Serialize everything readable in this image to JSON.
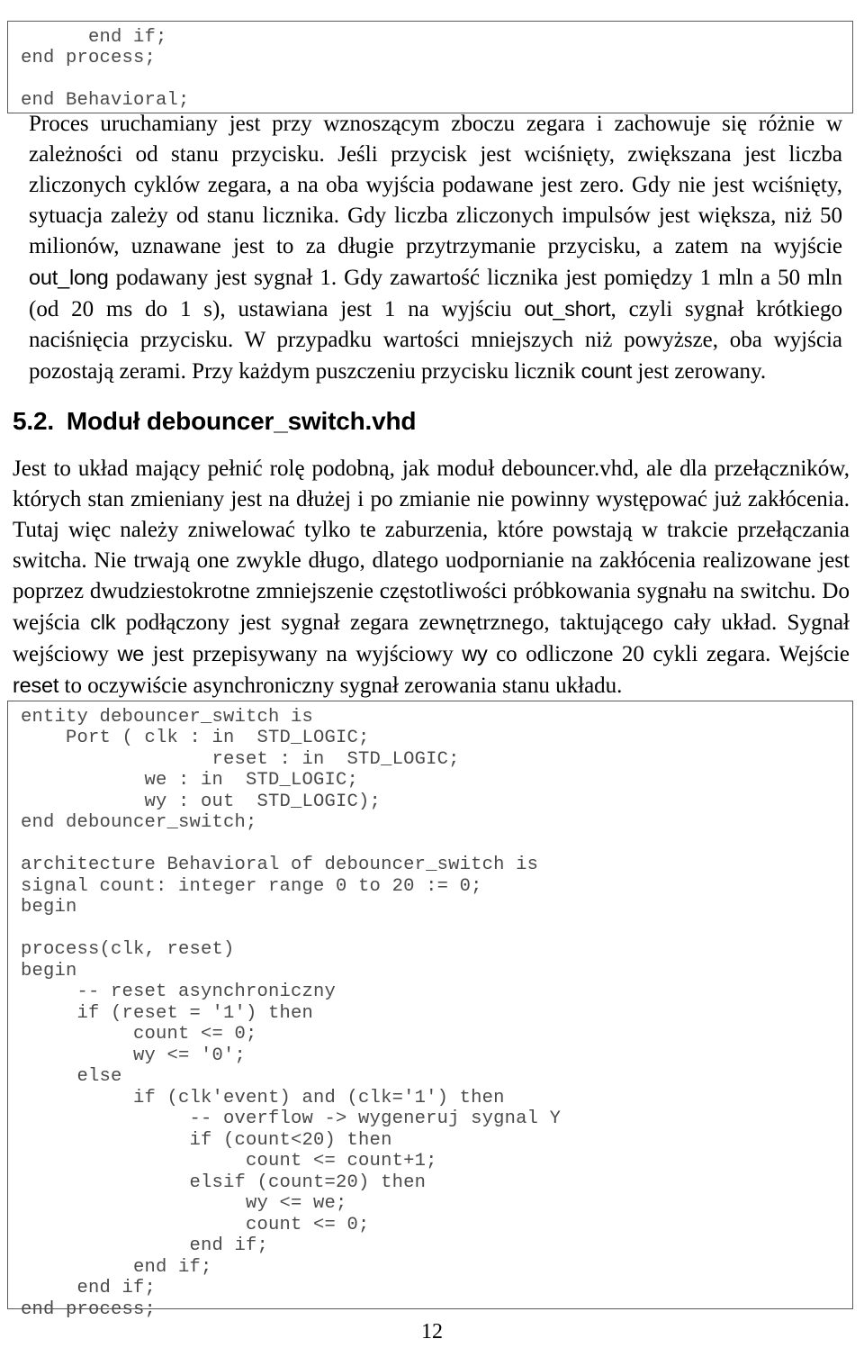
{
  "document": {
    "language": "pl",
    "page_number": "12"
  },
  "code_block_top": {
    "name": "vhdl-code-continued",
    "text": "      end if;\nend process;\n\nend Behavioral;"
  },
  "paragraph_1": {
    "segments": [
      {
        "type": "text",
        "value": "Proces uruchamiany jest przy wznoszącym zboczu zegara i zachowuje się różnie w zależności od stanu przycisku. Jeśli przycisk jest wciśnięty, zwiększana jest liczba zliczonych cyklów zegara, a na oba wyjścia podawane jest zero. Gdy nie jest wciśnięty, sytuacja zależy od stanu licznika. Gdy liczba zliczonych impulsów jest większa, niż 50 milionów, uznawane jest to za długie przytrzymanie przycisku, a zatem na wyjście "
      },
      {
        "type": "code",
        "value": "out_long"
      },
      {
        "type": "text",
        "value": " podawany jest sygnał 1. Gdy zawartość licznika jest pomiędzy 1 mln a 50 mln (od 20 ms do 1 s), ustawiana jest 1 na wyjściu "
      },
      {
        "type": "code",
        "value": "out_short"
      },
      {
        "type": "text",
        "value": ", czyli sygnał krótkiego naciśnięcia przycisku. W przypadku wartości mniejszych niż powyższe, oba wyjścia pozostają zerami. Przy każdym puszczeniu przycisku licznik "
      },
      {
        "type": "code",
        "value": "count"
      },
      {
        "type": "text",
        "value": " jest zerowany."
      }
    ]
  },
  "heading": {
    "number": "5.2.",
    "title": "Moduł debouncer_switch.vhd"
  },
  "paragraph_2": {
    "segments": [
      {
        "type": "text",
        "value": "Jest to układ mający pełnić rolę podobną, jak moduł debouncer.vhd, ale dla przełączników, których stan zmieniany jest na dłużej i po zmianie nie powinny występować już zakłócenia. Tutaj więc należy zniwelować tylko te zaburzenia, które powstają w trakcie przełączania switcha. Nie trwają one zwykle długo, dlatego uodpornianie na zakłócenia realizowane jest poprzez dwudziestokrotne zmniejszenie częstotliwości próbkowania sygnału na switchu. Do wejścia "
      },
      {
        "type": "code",
        "value": "clk"
      },
      {
        "type": "text",
        "value": " podłączony jest sygnał zegara zewnętrznego, taktującego cały układ. Sygnał wejściowy "
      },
      {
        "type": "code",
        "value": "we"
      },
      {
        "type": "text",
        "value": " jest przepisywany na wyjściowy "
      },
      {
        "type": "code",
        "value": "wy"
      },
      {
        "type": "text",
        "value": " co odliczone 20 cykli zegara. Wejście "
      },
      {
        "type": "code",
        "value": "reset"
      },
      {
        "type": "text",
        "value": " to oczywiście asynchroniczny sygnał zerowania stanu układu."
      }
    ]
  },
  "code_block_bottom": {
    "name": "vhdl-debouncer-switch-source",
    "text": "entity debouncer_switch is\n    Port ( clk : in  STD_LOGIC;\n                 reset : in  STD_LOGIC;\n           we : in  STD_LOGIC;\n           wy : out  STD_LOGIC);\nend debouncer_switch;\n\narchitecture Behavioral of debouncer_switch is\nsignal count: integer range 0 to 20 := 0;\nbegin\n\nprocess(clk, reset)\nbegin\n     -- reset asynchroniczny\n     if (reset = '1') then\n          count <= 0;\n          wy <= '0';\n     else\n          if (clk'event) and (clk='1') then\n               -- overflow -> wygeneruj sygnal Y\n               if (count<20) then\n                    count <= count+1;\n               elsif (count=20) then\n                    wy <= we;\n                    count <= 0;\n               end if;\n          end if;\n     end if;\nend process;"
  },
  "footer": {
    "page_number": "12"
  }
}
